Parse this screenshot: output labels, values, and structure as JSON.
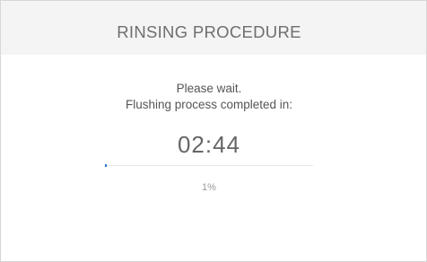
{
  "dialog": {
    "title": "RINSING PROCEDURE",
    "message_line1": "Please wait.",
    "message_line2": "Flushing process completed in:",
    "timer": "02:44",
    "progress_percent": 1,
    "progress_label": "1%"
  },
  "colors": {
    "header_bg": "#f4f4f5",
    "progress_fill": "#2c7ad9",
    "progress_track": "#e6e6e6"
  }
}
